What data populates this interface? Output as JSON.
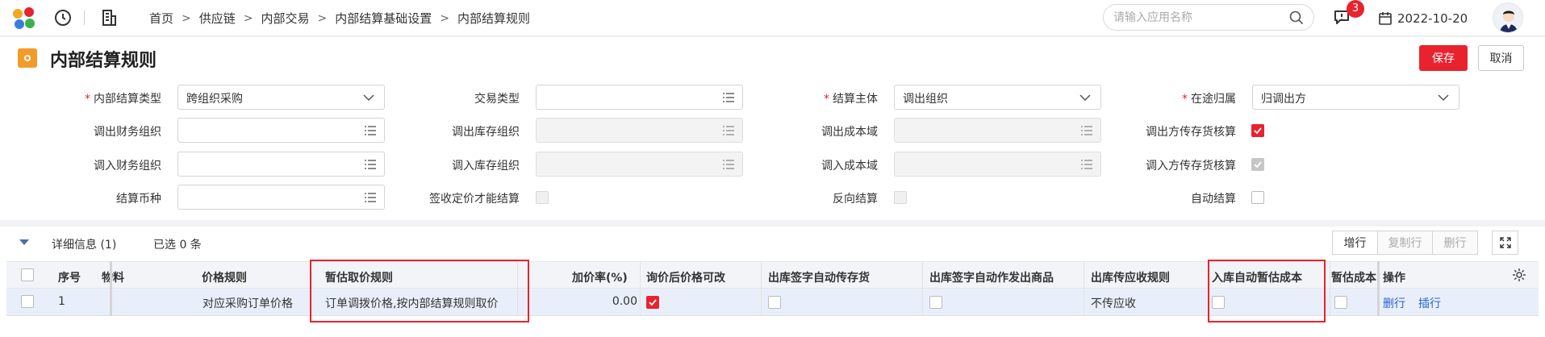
{
  "topbar": {
    "breadcrumb": [
      "首页",
      "供应链",
      "内部交易",
      "内部结算基础设置",
      "内部结算规则"
    ],
    "search_placeholder": "请输入应用名称",
    "notification_count": "3",
    "date": "2022-10-20"
  },
  "page": {
    "title": "内部结算规则",
    "save_label": "保存",
    "cancel_label": "取消"
  },
  "form": {
    "settle_type_label": "内部结算类型",
    "settle_type_value": "跨组织采购",
    "trade_type_label": "交易类型",
    "settle_subject_label": "结算主体",
    "settle_subject_value": "调出组织",
    "transit_owner_label": "在途归属",
    "transit_owner_value": "归调出方",
    "out_fin_org_label": "调出财务组织",
    "out_inv_org_label": "调出库存组织",
    "out_cost_domain_label": "调出成本域",
    "out_inv_account_label": "调出方传存货核算",
    "in_fin_org_label": "调入财务组织",
    "in_inv_org_label": "调入库存组织",
    "in_cost_domain_label": "调入成本域",
    "in_inv_account_label": "调入方传存货核算",
    "currency_label": "结算币种",
    "sign_price_label": "签收定价才能结算",
    "reverse_label": "反向结算",
    "auto_settle_label": "自动结算"
  },
  "detail": {
    "title": "详细信息 (1)",
    "selected": "已选 0 条",
    "add_row": "增行",
    "copy_row": "复制行",
    "delete_row": "删行",
    "columns": [
      "序号",
      "物料",
      "价格规则",
      "暂估取价规则",
      "加价率(%)",
      "询价后价格可改",
      "出库签字自动传存货",
      "出库签字自动作发出商品",
      "出库传应收规则",
      "入库自动暂估成本",
      "暂估成本",
      "操作"
    ],
    "rows": [
      {
        "seq": "1",
        "price_rule": "对应采购订单价格",
        "estimate_rule": "订单调拨价格,按内部结算规则取价",
        "markup": "0.00",
        "receivable_rule": "不传应收",
        "action_delete": "删行",
        "action_insert": "插行"
      }
    ]
  },
  "colors": {
    "accent": "#e8232e",
    "link": "#2b63d0",
    "orange": "#f29b2a"
  }
}
